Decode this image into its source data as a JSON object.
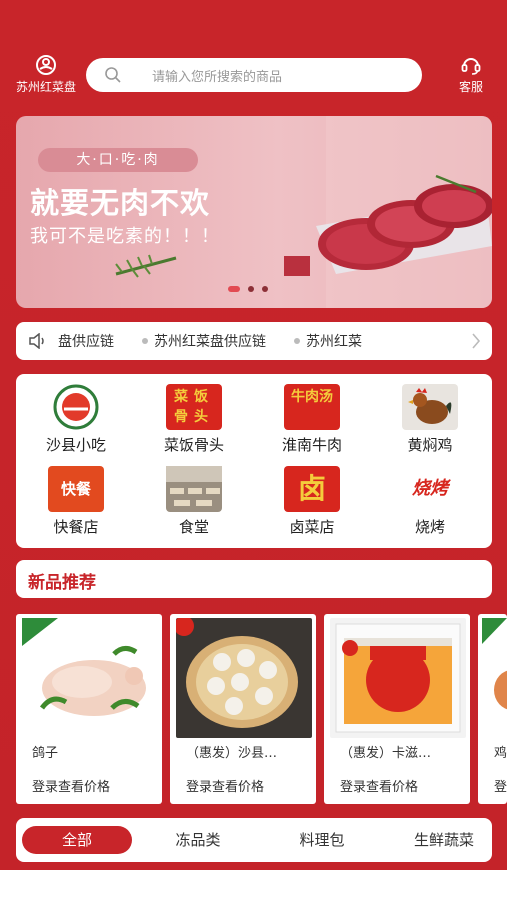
{
  "header": {
    "logo_text": "苏州红菜盘",
    "search_placeholder": "请输入您所搜索的商品",
    "service_label": "客服"
  },
  "banner": {
    "tag": "大·口·吃·肉",
    "title": "就要无肉不欢",
    "subtitle": "我可不是吃素的！！！",
    "dots": 3,
    "active_dot": 0
  },
  "notice": {
    "items": [
      "盘供应链",
      "苏州红菜盘供应链",
      "苏州红菜"
    ]
  },
  "categories": [
    {
      "label": "沙县小吃",
      "icon": "shaxian-logo-icon"
    },
    {
      "label": "菜饭骨头",
      "icon": "caifan-logo-icon",
      "logo_text": "菜饭骨头"
    },
    {
      "label": "淮南牛肉",
      "icon": "niurou-logo-icon",
      "logo_text": "牛肉汤"
    },
    {
      "label": "黄焖鸡",
      "icon": "chicken-icon"
    },
    {
      "label": "快餐店",
      "icon": "kuaican-logo-icon",
      "logo_text": "快餐"
    },
    {
      "label": "食堂",
      "icon": "canteen-icon"
    },
    {
      "label": "卤菜店",
      "icon": "lu-logo-icon",
      "logo_text": "卤"
    },
    {
      "label": "烧烤",
      "icon": "bbq-logo-icon",
      "logo_text": "烧烤"
    }
  ],
  "new_section": {
    "title": "新品推荐"
  },
  "products": [
    {
      "name": "鸽子",
      "price_text": "登录查看价格"
    },
    {
      "name": "（惠发）沙县…",
      "price_text": "登录查看价格"
    },
    {
      "name": "（惠发）卡滋…",
      "price_text": "登录查看价格"
    },
    {
      "name": "鸡",
      "price_text": "登"
    }
  ],
  "tabs": [
    {
      "label": "全部",
      "active": true
    },
    {
      "label": "冻品类",
      "active": false
    },
    {
      "label": "料理包",
      "active": false
    },
    {
      "label": "生鲜蔬菜",
      "active": false
    }
  ],
  "colors": {
    "brand_red": "#c8252a",
    "card_white": "#ffffff"
  }
}
